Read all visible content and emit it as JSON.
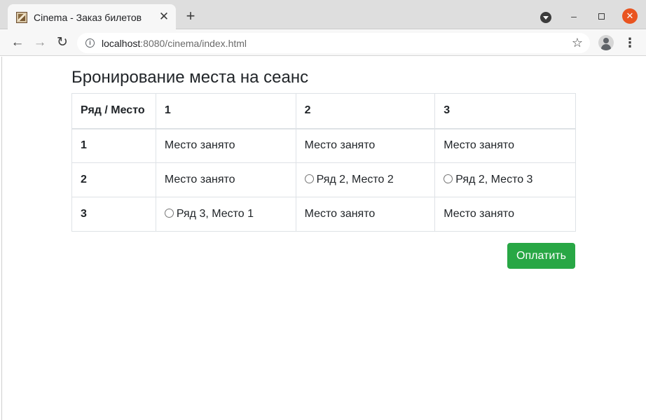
{
  "browser": {
    "tab": {
      "title": "Cinema - Заказ билетов",
      "close_glyph": "✕",
      "favicon": "cinema-favicon-icon"
    },
    "new_tab_glyph": "+",
    "window_controls": {
      "minimize": "–",
      "close": "✕"
    },
    "nav": {
      "back": "←",
      "forward": "→",
      "reload": "↻"
    },
    "address": {
      "host": "localhost",
      "path": ":8080/cinema/index.html",
      "info_glyph": "i",
      "bookmark_glyph": "☆"
    },
    "menu_glyph": "⋮"
  },
  "page": {
    "heading": "Бронирование места на сеанс",
    "table": {
      "headers": [
        "Ряд / Место",
        "1",
        "2",
        "3"
      ],
      "rows": [
        {
          "row": "1",
          "seats": [
            {
              "status": "occupied",
              "text": "Место занято"
            },
            {
              "status": "occupied",
              "text": "Место занято"
            },
            {
              "status": "occupied",
              "text": "Место занято"
            }
          ]
        },
        {
          "row": "2",
          "seats": [
            {
              "status": "occupied",
              "text": "Место занято"
            },
            {
              "status": "available",
              "text": "Ряд 2, Место 2"
            },
            {
              "status": "available",
              "text": "Ряд 2, Место 3"
            }
          ]
        },
        {
          "row": "3",
          "seats": [
            {
              "status": "available",
              "text": "Ряд 3, Место 1"
            },
            {
              "status": "occupied",
              "text": "Место занято"
            },
            {
              "status": "occupied",
              "text": "Место занято"
            }
          ]
        }
      ]
    },
    "pay_button": "Оплатить",
    "colors": {
      "pay_button": "#28a745",
      "border": "#dee2e6",
      "text": "#212529"
    }
  }
}
